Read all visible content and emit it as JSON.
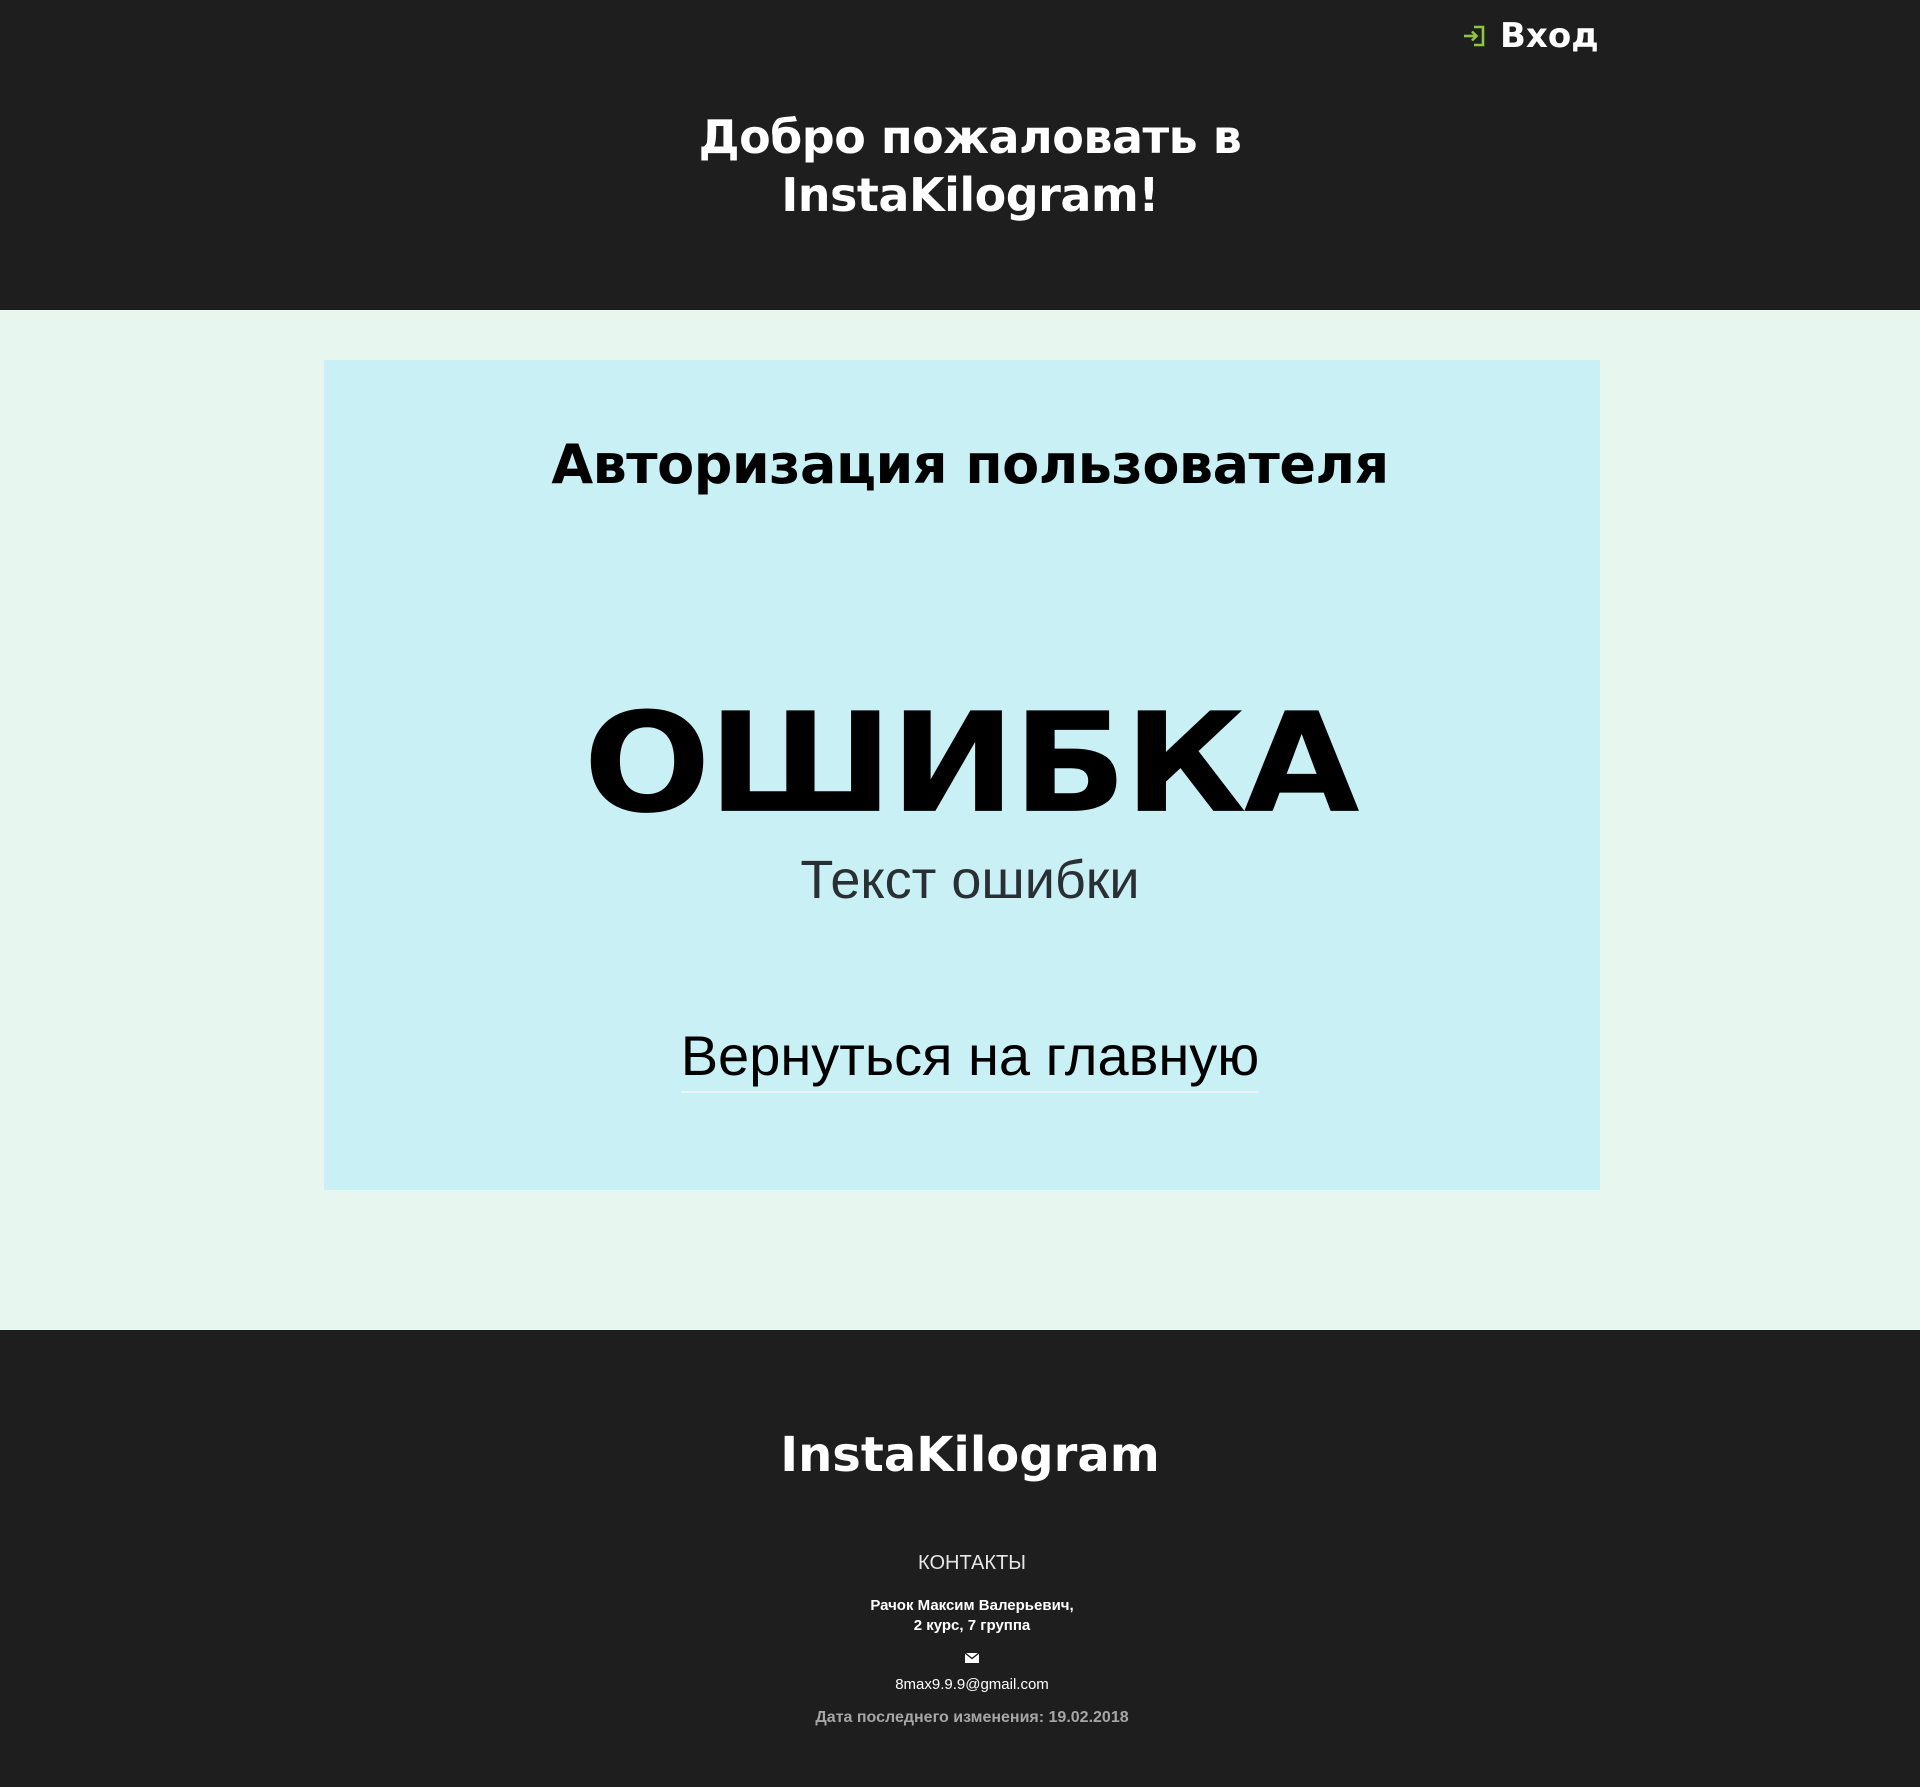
{
  "header": {
    "login_label": "Вход",
    "login_icon": "sign-in-icon",
    "welcome_line1": "Добро пожаловать в",
    "welcome_line2": "InstaKilogram!"
  },
  "main": {
    "card_title": "Авторизация пользователя",
    "error_title": "ОШИБКА",
    "error_text": "Текст ошибки",
    "home_link": "Вернуться на главную"
  },
  "footer": {
    "brand": "InstaKilogram",
    "contacts_heading": "КОНТАКТЫ",
    "author_line1": "Рачок Максим Валерьевич,",
    "author_line2": "2 курс, 7 группа",
    "mail_icon": "envelope-icon",
    "email": "8max9.9.9@gmail.com",
    "last_modified": "Дата последнего изменения: 19.02.2018"
  },
  "colors": {
    "header_bg": "#1e1e1e",
    "page_bg": "#e7f6ef",
    "card_bg": "#c9f1f5",
    "accent_icon": "#8dc63f"
  }
}
